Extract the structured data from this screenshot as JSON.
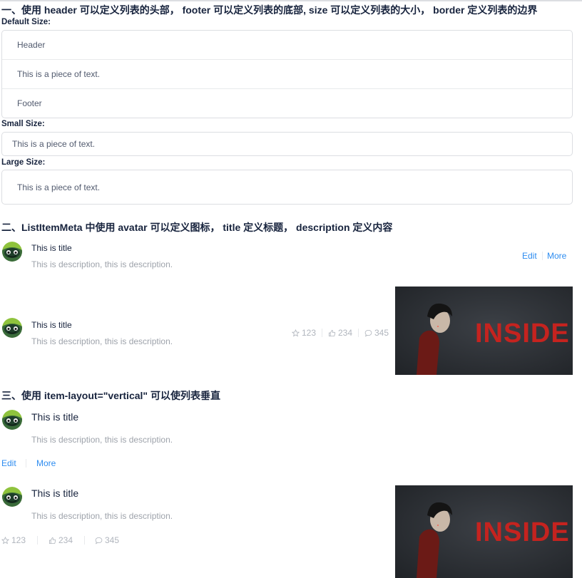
{
  "section1": {
    "heading": "一、使用 header 可以定义列表的头部， footer 可以定义列表的底部, size 可以定义列表的大小， border 定义列表的边界",
    "default_label": "Default Size:",
    "default_rows": [
      "Header",
      "This is a piece of text.",
      "Footer"
    ],
    "small_label": "Small Size:",
    "small_row": "This is a piece of text.",
    "large_label": "Large Size:",
    "large_row": "This is a piece of text."
  },
  "section2": {
    "heading": "二、ListItemMeta 中使用 avatar 可以定义图标， title 定义标题， description 定义内容",
    "item1": {
      "title": "This is title",
      "description": "This is description, this is description.",
      "edit": "Edit",
      "more": "More"
    },
    "item2": {
      "title": "This is title",
      "description": "This is description, this is description.",
      "star": "123",
      "like": "234",
      "comment": "345",
      "image_text": "INSIDE"
    }
  },
  "section3": {
    "heading": "三、使用 item-layout=\"vertical\" 可以使列表垂直",
    "item1": {
      "title": "This is title",
      "description": "This is description, this is description.",
      "edit": "Edit",
      "more": "More"
    },
    "item2": {
      "title": "This is title",
      "description": "This is description, this is description.",
      "star": "123",
      "like": "234",
      "comment": "345",
      "image_text": "INSIDE"
    }
  },
  "colors": {
    "link": "#2d8cf0",
    "border": "#dcdee2",
    "title": "#17233d",
    "description": "#9ea3ab",
    "image_text": "#c5231f"
  },
  "icons": [
    "star-icon",
    "like-icon",
    "comment-icon",
    "avatar-icon"
  ]
}
